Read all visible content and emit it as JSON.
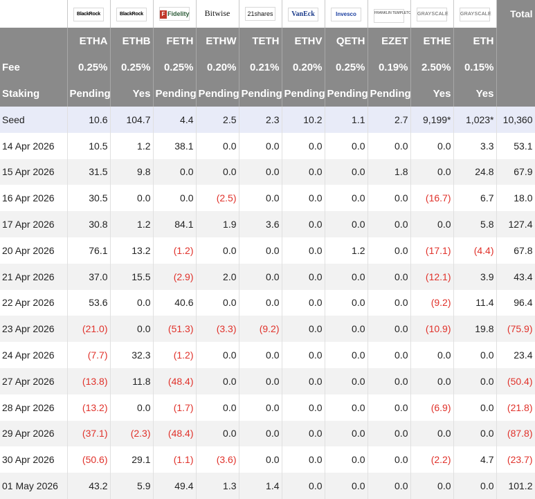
{
  "header": {
    "total_label": "Total",
    "fee_label": "Fee",
    "staking_label": "Staking"
  },
  "funds": [
    {
      "logo_icon": "blackrock-logo",
      "logo_text": "BlackRock",
      "ticker": "ETHA",
      "fee": "0.25%",
      "staking": "Pending"
    },
    {
      "logo_icon": "blackrock-logo",
      "logo_text": "BlackRock",
      "ticker": "ETHB",
      "fee": "0.25%",
      "staking": "Yes"
    },
    {
      "logo_icon": "fidelity-logo",
      "logo_text": "Fidelity",
      "ticker": "FETH",
      "fee": "0.25%",
      "staking": "Pending"
    },
    {
      "logo_icon": "bitwise-logo",
      "logo_text": "Bitwise",
      "ticker": "ETHW",
      "fee": "0.20%",
      "staking": "Pending"
    },
    {
      "logo_icon": "21shares-logo",
      "logo_text": "21shares",
      "ticker": "TETH",
      "fee": "0.21%",
      "staking": "Pending"
    },
    {
      "logo_icon": "vaneck-logo",
      "logo_text": "VanEck",
      "ticker": "ETHV",
      "fee": "0.20%",
      "staking": "Pending"
    },
    {
      "logo_icon": "invesco-logo",
      "logo_text": "Invesco",
      "ticker": "QETH",
      "fee": "0.25%",
      "staking": "Pending"
    },
    {
      "logo_icon": "franklin-templeton-logo",
      "logo_text": "FRANKLIN TEMPLETON",
      "ticker": "EZET",
      "fee": "0.19%",
      "staking": "Pending"
    },
    {
      "logo_icon": "grayscale-logo",
      "logo_text": "GRAYSCALE",
      "ticker": "ETHE",
      "fee": "2.50%",
      "staking": "Yes"
    },
    {
      "logo_icon": "grayscale-logo",
      "logo_text": "GRAYSCALE",
      "ticker": "ETH",
      "fee": "0.15%",
      "staking": "Yes"
    }
  ],
  "rows": [
    {
      "label": "Seed",
      "values": [
        "10.6",
        "104.7",
        "4.4",
        "2.5",
        "2.3",
        "10.2",
        "1.1",
        "2.7",
        "9,199*",
        "1,023*"
      ],
      "total": "10,360"
    },
    {
      "label": "14 Apr 2026",
      "values": [
        "10.5",
        "1.2",
        "38.1",
        "0.0",
        "0.0",
        "0.0",
        "0.0",
        "0.0",
        "0.0",
        "3.3"
      ],
      "total": "53.1"
    },
    {
      "label": "15 Apr 2026",
      "values": [
        "31.5",
        "9.8",
        "0.0",
        "0.0",
        "0.0",
        "0.0",
        "0.0",
        "1.8",
        "0.0",
        "24.8"
      ],
      "total": "67.9"
    },
    {
      "label": "16 Apr 2026",
      "values": [
        "30.5",
        "0.0",
        "0.0",
        "(2.5)",
        "0.0",
        "0.0",
        "0.0",
        "0.0",
        "(16.7)",
        "6.7"
      ],
      "total": "18.0"
    },
    {
      "label": "17 Apr 2026",
      "values": [
        "30.8",
        "1.2",
        "84.1",
        "1.9",
        "3.6",
        "0.0",
        "0.0",
        "0.0",
        "0.0",
        "5.8"
      ],
      "total": "127.4"
    },
    {
      "label": "20 Apr 2026",
      "values": [
        "76.1",
        "13.2",
        "(1.2)",
        "0.0",
        "0.0",
        "0.0",
        "1.2",
        "0.0",
        "(17.1)",
        "(4.4)"
      ],
      "total": "67.8"
    },
    {
      "label": "21 Apr 2026",
      "values": [
        "37.0",
        "15.5",
        "(2.9)",
        "2.0",
        "0.0",
        "0.0",
        "0.0",
        "0.0",
        "(12.1)",
        "3.9"
      ],
      "total": "43.4"
    },
    {
      "label": "22 Apr 2026",
      "values": [
        "53.6",
        "0.0",
        "40.6",
        "0.0",
        "0.0",
        "0.0",
        "0.0",
        "0.0",
        "(9.2)",
        "11.4"
      ],
      "total": "96.4"
    },
    {
      "label": "23 Apr 2026",
      "values": [
        "(21.0)",
        "0.0",
        "(51.3)",
        "(3.3)",
        "(9.2)",
        "0.0",
        "0.0",
        "0.0",
        "(10.9)",
        "19.8"
      ],
      "total": "(75.9)"
    },
    {
      "label": "24 Apr 2026",
      "values": [
        "(7.7)",
        "32.3",
        "(1.2)",
        "0.0",
        "0.0",
        "0.0",
        "0.0",
        "0.0",
        "0.0",
        "0.0"
      ],
      "total": "23.4"
    },
    {
      "label": "27 Apr 2026",
      "values": [
        "(13.8)",
        "11.8",
        "(48.4)",
        "0.0",
        "0.0",
        "0.0",
        "0.0",
        "0.0",
        "0.0",
        "0.0"
      ],
      "total": "(50.4)"
    },
    {
      "label": "28 Apr 2026",
      "values": [
        "(13.2)",
        "0.0",
        "(1.7)",
        "0.0",
        "0.0",
        "0.0",
        "0.0",
        "0.0",
        "(6.9)",
        "0.0"
      ],
      "total": "(21.8)"
    },
    {
      "label": "29 Apr 2026",
      "values": [
        "(37.1)",
        "(2.3)",
        "(48.4)",
        "0.0",
        "0.0",
        "0.0",
        "0.0",
        "0.0",
        "0.0",
        "0.0"
      ],
      "total": "(87.8)"
    },
    {
      "label": "30 Apr 2026",
      "values": [
        "(50.6)",
        "29.1",
        "(1.1)",
        "(3.6)",
        "0.0",
        "0.0",
        "0.0",
        "0.0",
        "(2.2)",
        "4.7"
      ],
      "total": "(23.7)"
    },
    {
      "label": "01 May 2026",
      "values": [
        "43.2",
        "5.9",
        "49.4",
        "1.3",
        "1.4",
        "0.0",
        "0.0",
        "0.0",
        "0.0",
        "0.0"
      ],
      "total": "101.2"
    }
  ],
  "colors": {
    "header_bg": "#8a8a8a",
    "seed_bg": "#e8ebf8",
    "stripe_bg": "#f2f2f2",
    "negative": "#e0312a"
  }
}
